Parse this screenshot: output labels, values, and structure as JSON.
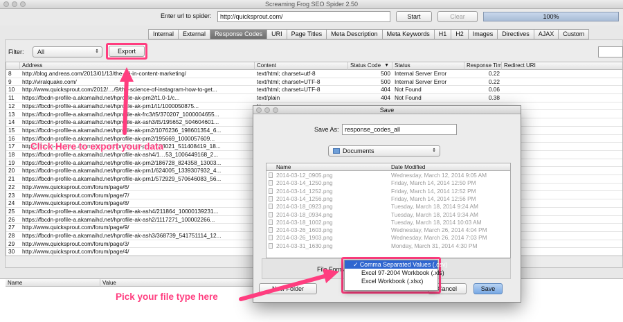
{
  "window": {
    "title": "Screaming Frog SEO Spider 2.50"
  },
  "urlbar": {
    "label": "Enter url to spider:",
    "url": "http://quicksprout.com/",
    "start": "Start",
    "clear": "Clear",
    "progress": "100%",
    "progress_value": 1.0
  },
  "tabs": [
    "Internal",
    "External",
    "Response Codes",
    "URI",
    "Page Titles",
    "Meta Description",
    "Meta Keywords",
    "H1",
    "H2",
    "Images",
    "Directives",
    "AJAX",
    "Custom"
  ],
  "active_tab": "Response Codes",
  "filter": {
    "label": "Filter:",
    "value": "All",
    "export": "Export"
  },
  "columns": {
    "address": "Address",
    "content": "Content",
    "status_code": "Status Code",
    "status": "Status",
    "response_time": "Response Time",
    "redirect": "Redirect URI"
  },
  "rows": [
    {
      "n": "8",
      "address": "http://blog.andreas.com/2013/01/13/the-roi-in-content-marketing/",
      "content": "text/html; charset=utf-8",
      "code": "500",
      "status": "Internal Server Error",
      "time": "0.22"
    },
    {
      "n": "9",
      "address": "http://viralquake.com/",
      "content": "text/html; charset=UTF-8",
      "code": "500",
      "status": "Internal Server Error",
      "time": "0.22"
    },
    {
      "n": "10",
      "address": "http://www.quicksprout.com/2012/…/9/the-science-of-instagram-how-to-get...",
      "content": "text/html; charset=UTF-8",
      "code": "404",
      "status": "Not Found",
      "time": "0.06"
    },
    {
      "n": "11",
      "address": "https://fbcdn-profile-a.akamaihd.net/hprofile-ak-prn2/t1.0-1/c...",
      "content": "text/plain",
      "code": "404",
      "status": "Not Found",
      "time": "0.38"
    },
    {
      "n": "12",
      "address": "https://fbcdn-profile-a.akamaihd.net/hprofile-ak-prn1/t1/1000050875...",
      "content": "te",
      "code": "",
      "status": "",
      "time": ""
    },
    {
      "n": "13",
      "address": "https://fbcdn-profile-a.akamaihd.net/hprofile-ak-frc3/t5/370207_1000004655...",
      "content": "te",
      "code": "",
      "status": "",
      "time": ""
    },
    {
      "n": "14",
      "address": "https://fbcdn-profile-a.akamaihd.net/hprofile-ak-ash3/t5/195652_504604601...",
      "content": "te",
      "code": "",
      "status": "",
      "time": ""
    },
    {
      "n": "15",
      "address": "https://fbcdn-profile-a.akamaihd.net/hprofile-ak-prn2/1076236_198601354_6...",
      "content": "te",
      "code": "",
      "status": "",
      "time": ""
    },
    {
      "n": "16",
      "address": "https://fbcdn-profile-a.akamaihd.net/hprofile-ak-prn2/195669_1000057609...",
      "content": "te",
      "code": "",
      "status": "",
      "time": ""
    },
    {
      "n": "17",
      "address": "https://fbcdn-profile-a.akamaihd.net/hprofile-ak-prn1/573021_511408419_18...",
      "content": "te",
      "code": "",
      "status": "",
      "time": ""
    },
    {
      "n": "18",
      "address": "https://fbcdn-profile-a.akamaihd.net/hprofile-ak-ash4/1…53_1006449168_2...",
      "content": "te",
      "code": "",
      "status": "",
      "time": ""
    },
    {
      "n": "19",
      "address": "https://fbcdn-profile-a.akamaihd.net/hprofile-ak-prn2/186728_824358_13003...",
      "content": "te",
      "code": "",
      "status": "",
      "time": ""
    },
    {
      "n": "20",
      "address": "https://fbcdn-profile-a.akamaihd.net/hprofile-ak-prn1/624005_1339307932_4...",
      "content": "te",
      "code": "",
      "status": "",
      "time": ""
    },
    {
      "n": "21",
      "address": "https://fbcdn-profile-a.akamaihd.net/hprofile-ak-prn1/572929_570646083_56...",
      "content": "te",
      "code": "",
      "status": "",
      "time": ""
    },
    {
      "n": "22",
      "address": "http://www.quicksprout.com/forum/page/6/",
      "content": "te",
      "code": "",
      "status": "",
      "time": ""
    },
    {
      "n": "23",
      "address": "http://www.quicksprout.com/forum/page/7/",
      "content": "te",
      "code": "",
      "status": "",
      "time": ""
    },
    {
      "n": "24",
      "address": "http://www.quicksprout.com/forum/page/8/",
      "content": "te",
      "code": "",
      "status": "",
      "time": ""
    },
    {
      "n": "25",
      "address": "https://fbcdn-profile-a.akamaihd.net/hprofile-ak-ash4/211864_10000139231...",
      "content": "te",
      "code": "",
      "status": "",
      "time": ""
    },
    {
      "n": "26",
      "address": "https://fbcdn-profile-a.akamaihd.net/hprofile-ak-ash2/1117271_100002266...",
      "content": "te",
      "code": "",
      "status": "",
      "time": ""
    },
    {
      "n": "27",
      "address": "http://www.quicksprout.com/forum/page/9/",
      "content": "te",
      "code": "",
      "status": "",
      "time": ""
    },
    {
      "n": "28",
      "address": "https://fbcdn-profile-a.akamaihd.net/hprofile-ak-ash3/368739_541751114_12...",
      "content": "te",
      "code": "",
      "status": "",
      "time": ""
    },
    {
      "n": "29",
      "address": "http://www.quicksprout.com/forum/page/3/",
      "content": "te",
      "code": "",
      "status": "",
      "time": ""
    },
    {
      "n": "30",
      "address": "http://www.quicksprout.com/forum/page/4/",
      "content": "te",
      "code": "",
      "status": "",
      "time": ""
    }
  ],
  "details": {
    "name": "Name",
    "value": "Value"
  },
  "dialog": {
    "title": "Save",
    "save_as_label": "Save As:",
    "save_as_value": "response_codes_all",
    "folder": "Documents",
    "col_name": "Name",
    "col_date": "Date Modified",
    "files": [
      {
        "name": "2014-03-12_0905.png",
        "date": "Wednesday, March 12, 2014 9:05 AM"
      },
      {
        "name": "2014-03-14_1250.png",
        "date": "Friday, March 14, 2014 12:50 PM"
      },
      {
        "name": "2014-03-14_1252.png",
        "date": "Friday, March 14, 2014 12:52 PM"
      },
      {
        "name": "2014-03-14_1256.png",
        "date": "Friday, March 14, 2014 12:56 PM"
      },
      {
        "name": "2014-03-18_0923.png",
        "date": "Tuesday, March 18, 2014 9:24 AM"
      },
      {
        "name": "2014-03-18_0934.png",
        "date": "Tuesday, March 18, 2014 9:34 AM"
      },
      {
        "name": "2014-03-18_1002.png",
        "date": "Tuesday, March 18, 2014 10:03 AM"
      },
      {
        "name": "2014-03-26_1603.png",
        "date": "Wednesday, March 26, 2014 4:04 PM"
      },
      {
        "name": "2014-03-26_1903.png",
        "date": "Wednesday, March 26, 2014 7:03 PM"
      },
      {
        "name": "2014-03-31_1630.png",
        "date": "Monday, March 31, 2014 4:30 PM"
      }
    ],
    "file_format_label": "File Format",
    "format_options": [
      "Comma Separated Values (.csv)",
      "Excel 97-2004 Workbook (.xls)",
      "Excel Workbook (.xlsx)"
    ],
    "new_folder": "New Folder",
    "cancel": "Cancel",
    "save": "Save"
  },
  "annotations": {
    "export": "Click Here to export your data",
    "filetype": "Pick your file type here",
    "color": "#ff3d7f"
  }
}
